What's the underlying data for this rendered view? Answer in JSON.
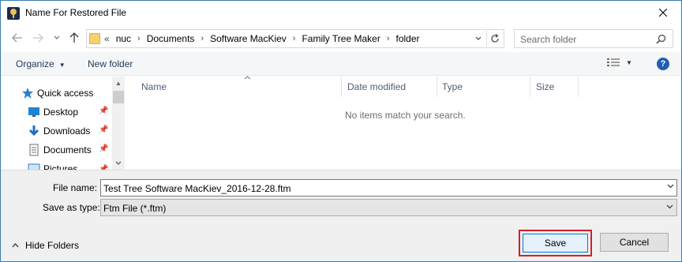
{
  "window": {
    "title": "Name For Restored File"
  },
  "address": {
    "overflow": "«",
    "crumbs": [
      "nuc",
      "Documents",
      "Software MacKiev",
      "Family Tree Maker",
      "folder"
    ]
  },
  "search": {
    "placeholder": "Search folder"
  },
  "toolbar": {
    "organize_label": "Organize",
    "new_folder_label": "New folder",
    "help_label": "?"
  },
  "navpane": {
    "items": [
      {
        "label": "Quick access",
        "icon": "star-icon"
      },
      {
        "label": "Desktop",
        "icon": "desktop-icon"
      },
      {
        "label": "Downloads",
        "icon": "download-icon"
      },
      {
        "label": "Documents",
        "icon": "documents-icon"
      },
      {
        "label": "Pictures",
        "icon": "pictures-icon"
      }
    ]
  },
  "filelist": {
    "columns": [
      "Name",
      "Date modified",
      "Type",
      "Size"
    ],
    "empty_message": "No items match your search."
  },
  "form": {
    "filename_label": "File name:",
    "filename_value": "Test Tree Software MacKiev_2016-12-28.ftm",
    "type_label": "Save as type:",
    "type_value": "Ftm File (*.ftm)"
  },
  "footer": {
    "hide_folders_label": "Hide Folders",
    "save_label": "Save",
    "cancel_label": "Cancel"
  },
  "colors": {
    "accent": "#0078d7",
    "highlight_outline": "#d0202a",
    "link": "#1e395b"
  }
}
